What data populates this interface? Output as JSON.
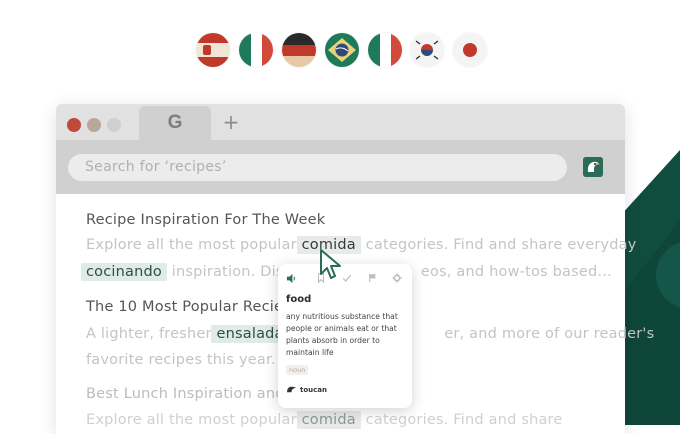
{
  "flags": [
    {
      "name": "spain-flag-icon",
      "stripes": [
        "#c0392b",
        "#f1e6d6",
        "#c0392b"
      ]
    },
    {
      "name": "italy-flag-icon",
      "stripes": [
        "#1f7a5a",
        "#ffffff",
        "#d24a3c"
      ],
      "vertical": true
    },
    {
      "name": "germany-flag-icon",
      "stripes": [
        "#2a2a2a",
        "#c0392b",
        "#e8c9a6"
      ]
    },
    {
      "name": "brazil-flag-icon",
      "base": "#1f7a5a"
    },
    {
      "name": "italy-flag-icon-2",
      "stripes": [
        "#1f7a5a",
        "#ffffff",
        "#d24a3c"
      ],
      "vertical": true
    },
    {
      "name": "korea-flag-icon",
      "base": "#f4f4f4"
    },
    {
      "name": "japan-flag-icon",
      "base": "#f4f4f4"
    }
  ],
  "colors": {
    "accent": "#2a6b5a",
    "dark_bg": "#114d3f",
    "highlight": "#dfece6"
  },
  "browser": {
    "tab_icon_letter": "G",
    "new_tab_label": "+",
    "search": {
      "placeholder": "Search for ‘recipes’"
    }
  },
  "article": {
    "heading_1": "Recipe Inspiration For The Week",
    "line_1a": "Explore all the most popular ",
    "line_1_word": "comida",
    "line_1b": " categories. Find and share everyday",
    "line_2_word": "cocinando",
    "line_2a": " inspiration. Disco",
    "line_2b": "eos, and how-tos based…",
    "heading_2": "The 10 Most Popular Recies o",
    "line_3a": "A lighter, fresher ",
    "line_3_word": "ensalada",
    "line_3b": " ,",
    "line_3c": "er, and more of our reader's",
    "line_4": "favorite recipes this year.",
    "heading_3": "Best Lunch Inspiration and T",
    "line_5a": "Explore all the most popular ",
    "line_5_word": "comida",
    "line_5b": " categories. Find and share"
  },
  "popup": {
    "word": "food",
    "definition": "any nutritious substance that people or animals eat or that plants absorb in order to maintain life",
    "part_of_speech": "noun",
    "brand": "toucan"
  }
}
